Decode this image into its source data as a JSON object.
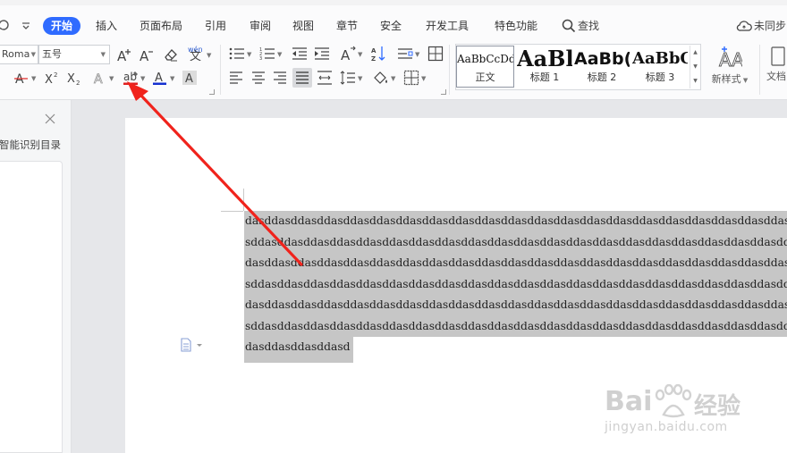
{
  "menu": {
    "undo_icon": "redo-arrow-icon",
    "more_icon": "chevron-down-icon",
    "tabs": [
      {
        "label": "开始",
        "active": true
      },
      {
        "label": "插入"
      },
      {
        "label": "页面布局"
      },
      {
        "label": "引用"
      },
      {
        "label": "审阅"
      },
      {
        "label": "视图"
      },
      {
        "label": "章节"
      },
      {
        "label": "安全"
      },
      {
        "label": "开发工具"
      },
      {
        "label": "特色功能"
      }
    ],
    "search_label": "查找",
    "sync_label": "未同步"
  },
  "font": {
    "name": "Roma",
    "size": "五号",
    "phonetic_label": "wén",
    "phonetic_char": "文"
  },
  "styles": [
    {
      "sample": "AaBbCcDd",
      "name": "正文"
    },
    {
      "sample": "AaBl",
      "name": "标题 1"
    },
    {
      "sample": "AaBb(",
      "name": "标题 2"
    },
    {
      "sample": "AaBbC",
      "name": "标题 3"
    }
  ],
  "new_style_label": "新样式",
  "doc_label": "文档",
  "panel": {
    "title": "智能识别目录"
  },
  "document": {
    "lines": [
      "dasddasddasddasddasddasddasddasddasddasddasddasddasddasddasddasddasddasddasddasddasddasddasddasd",
      "sddasddasddasddasddasddasddasddasddasddasddasddasddasddasddasddasddasddasddasddasddasddasddasddasd",
      "dasddasddasddasddasddasddasddasddasddasddasddasddasddasddasddasddasddasddasddasddasddasddasddasd",
      "sddasddasddasddasddasddasddasddasddasddasddasddasddasddasddasddasddasddasddasddasddasddasddasddasd",
      "dasddasddasddasddasddasddasddasddasddasddasddasddasddasddasddasddasddasddasddasddasddasddasddasd",
      "sddasddasddasddasddasddasddasddasddasddasddasddasddasddasddasddasddasddasddasddasddasddasddasddasd",
      "dasddasddasddasd"
    ]
  },
  "annotation": {
    "type": "arrow",
    "color": "#f0231c",
    "target": "highlight-button"
  },
  "watermark": {
    "brand_left": "Bai",
    "brand_right": "经验",
    "url": "jingyan.baidu.com",
    "color": "#d0d0d0"
  },
  "colors": {
    "accent": "#2f6bff",
    "selection": "#c6c6c6",
    "underline_red": "#e02020",
    "font_color_blue": "#1530d0"
  }
}
